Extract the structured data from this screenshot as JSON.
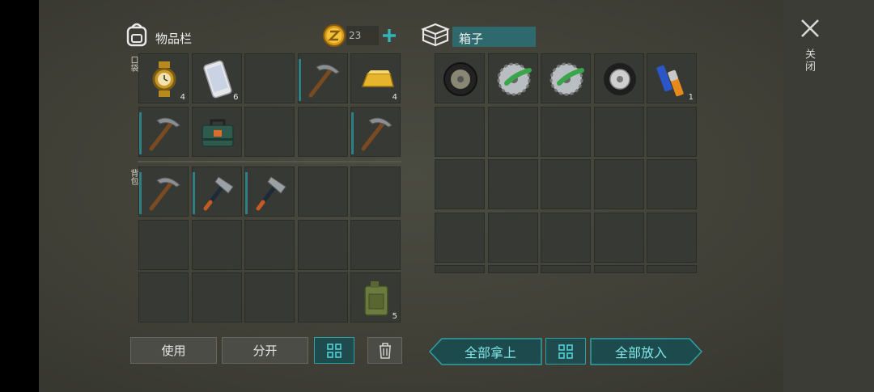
{
  "inventory": {
    "title": "物品栏",
    "coins": "23",
    "pockets_label": "口袋",
    "backpack_label": "背包"
  },
  "box": {
    "title": "箱子"
  },
  "buttons": {
    "use": "使用",
    "split": "分开",
    "take_all": "全部拿上",
    "put_all": "全部放入"
  },
  "close": {
    "label": "关闭"
  },
  "pocket_slots": [
    {
      "item": "gold-watch-icon",
      "qty": "4"
    },
    {
      "item": "smartphone-icon",
      "qty": "6"
    },
    {
      "item": "",
      "qty": ""
    },
    {
      "item": "pickaxe-icon",
      "qty": ""
    },
    {
      "item": "gold-bar-icon",
      "qty": "4"
    },
    {
      "item": "pickaxe-icon",
      "qty": ""
    },
    {
      "item": "toolbox-icon",
      "qty": ""
    },
    {
      "item": "",
      "qty": ""
    },
    {
      "item": "",
      "qty": ""
    },
    {
      "item": "pickaxe-icon",
      "qty": ""
    }
  ],
  "backpack_slots": [
    {
      "item": "pickaxe-icon",
      "qty": ""
    },
    {
      "item": "hatchet-icon",
      "qty": ""
    },
    {
      "item": "hatchet-icon",
      "qty": ""
    },
    {
      "item": "",
      "qty": ""
    },
    {
      "item": "",
      "qty": ""
    },
    {
      "item": "",
      "qty": ""
    },
    {
      "item": "",
      "qty": ""
    },
    {
      "item": "",
      "qty": ""
    },
    {
      "item": "",
      "qty": ""
    },
    {
      "item": "",
      "qty": ""
    },
    {
      "item": "",
      "qty": ""
    },
    {
      "item": "",
      "qty": ""
    },
    {
      "item": "",
      "qty": ""
    },
    {
      "item": "",
      "qty": ""
    },
    {
      "item": "fuel-canister-icon",
      "qty": "5"
    }
  ],
  "box_slots": [
    {
      "item": "tire-icon",
      "qty": ""
    },
    {
      "item": "saw-blade-icon",
      "qty": ""
    },
    {
      "item": "saw-blade-icon",
      "qty": ""
    },
    {
      "item": "wheel-icon",
      "qty": ""
    },
    {
      "item": "batteries-icon",
      "qty": "1"
    }
  ],
  "colors": {
    "accent": "#2fa1a5",
    "slot": "#373935",
    "bg": "#434339"
  }
}
